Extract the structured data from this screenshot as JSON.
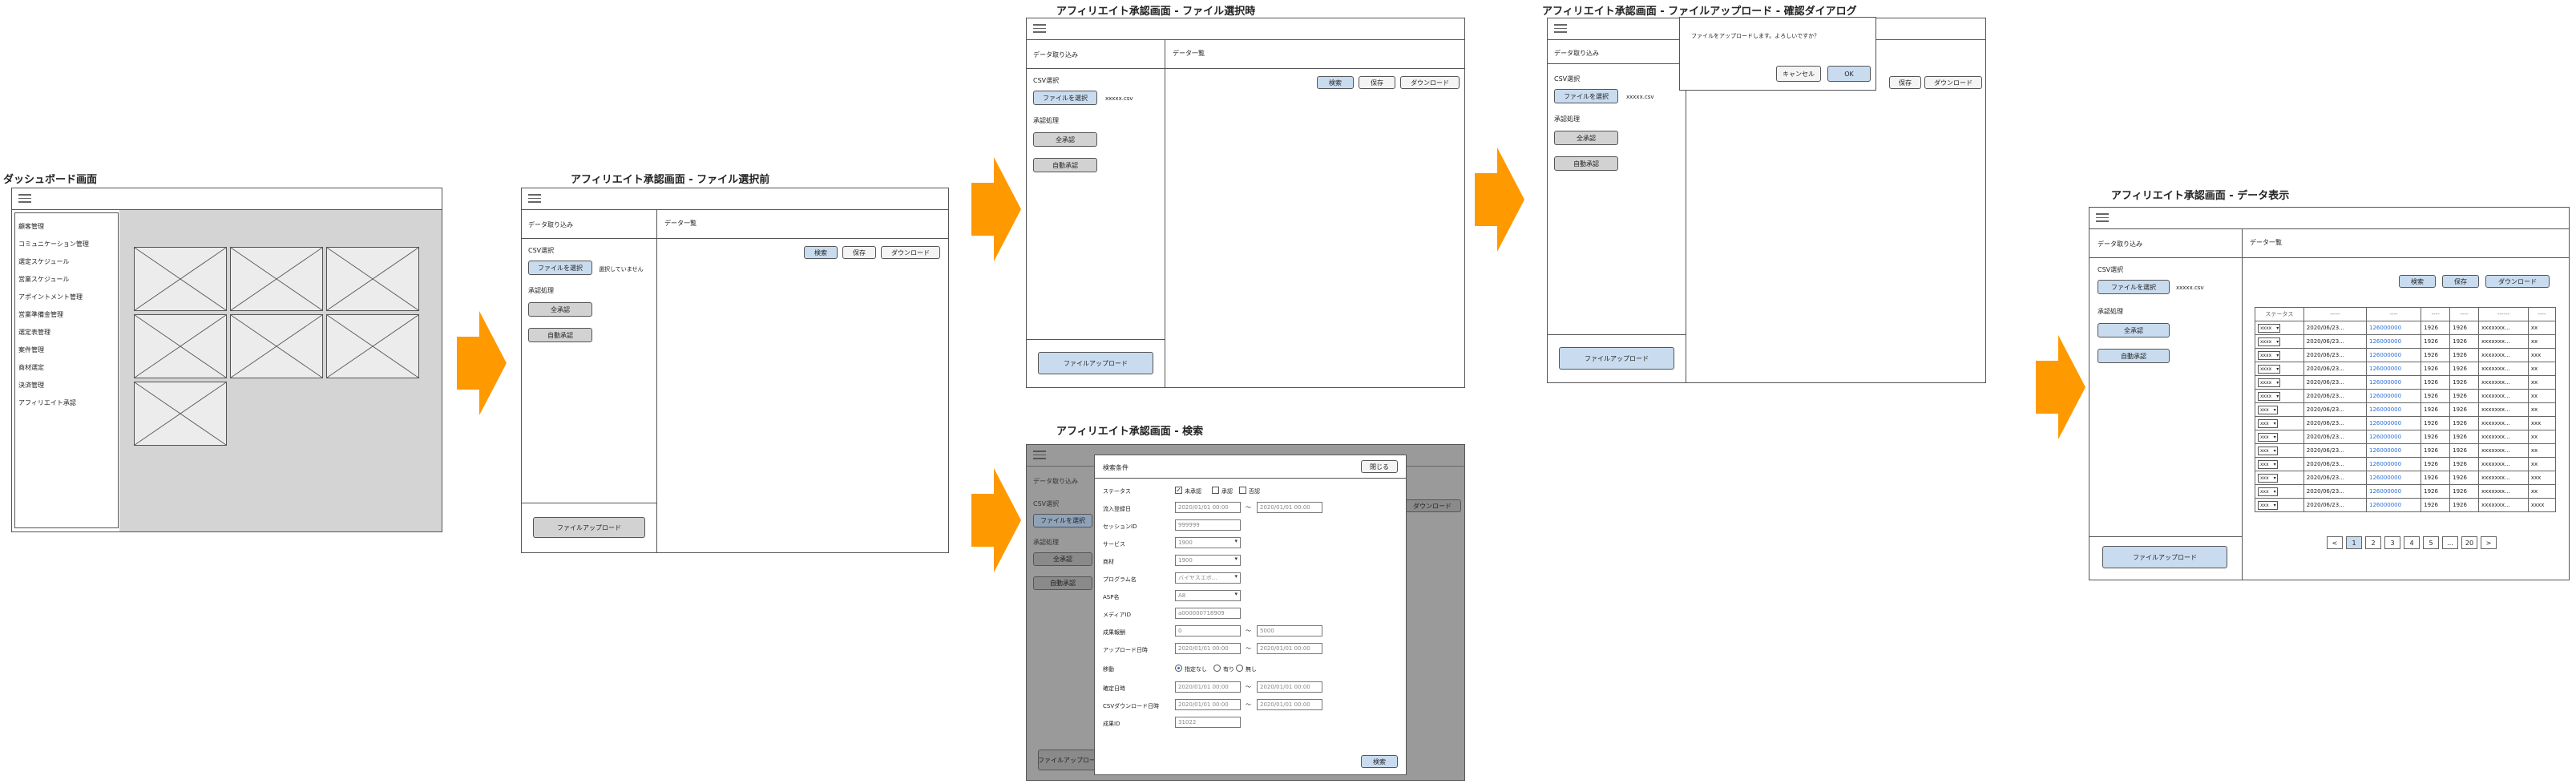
{
  "titles": {
    "dashboard": "ダッシュボード画面",
    "before": "アフィリエイト承認画面 - ファイル選択前",
    "selected": "アフィリエイト承認画面 - ファイル選択時",
    "confirm": "アフィリエイト承認画面 - ファイルアップロード - 確認ダイアログ",
    "search": "アフィリエイト承認画面 - 検索",
    "data": "アフィリエイト承認画面 - データ表示"
  },
  "dashboard": {
    "menu": [
      "顧客管理",
      "コミュニケーション管理",
      "選定スケジュール",
      "営業スケジュール",
      "アポイントメント管理",
      "営業準備金管理",
      "選定表管理",
      "案件管理",
      "商材選定",
      "決済管理",
      "アフィリエイト承認"
    ]
  },
  "common": {
    "import_header": "データ取り込み",
    "list_header": "データ一覧",
    "csv_label": "CSV選択",
    "file_button": "ファイルを選択",
    "approval_label": "承認処理",
    "all_approve": "全承認",
    "auto_approve": "自動承認",
    "upload_button": "ファイルアップロード",
    "search_button": "検索",
    "save_button": "保存",
    "download_button": "ダウンロード",
    "no_file": "選択していません",
    "file_name": "xxxxx.csv"
  },
  "confirm_dialog": {
    "message": "ファイルをアップロードします。よろしいですか？",
    "cancel": "キャンセル",
    "ok": "OK"
  },
  "search_dialog": {
    "title": "検索条件",
    "close": "閉じる",
    "search": "検索",
    "rows": [
      {
        "label": "ステータス"
      },
      {
        "label": "流入登録日"
      },
      {
        "label": "セッションID"
      },
      {
        "label": "サービス"
      },
      {
        "label": "商材"
      },
      {
        "label": "プログラム名"
      },
      {
        "label": "ASP名"
      },
      {
        "label": "メディアID"
      },
      {
        "label": "成果報酬"
      },
      {
        "label": "アップロード日時"
      },
      {
        "label": "移動"
      },
      {
        "label": "確定日時"
      },
      {
        "label": "CSVダウンロード日時"
      },
      {
        "label": "成果ID"
      }
    ],
    "status_options": [
      "未承認",
      "承認",
      "否認"
    ],
    "move_options": [
      "指定なし",
      "有り",
      "無し"
    ],
    "date_value": "2020/01/01 00:00",
    "session_value": "999999",
    "service_value": "1900",
    "product_value": "1900",
    "program_value": "バイヤスエボ...",
    "asp_value": "A8",
    "media_value": "a000000718909",
    "reward_from": "0",
    "reward_to": "5000",
    "result_id": "31022",
    "tilde": "〜"
  },
  "table": {
    "headers": [
      "ステータス",
      "-----",
      "----",
      "----",
      "----",
      "------",
      "----"
    ],
    "rows": [
      [
        "xxxx",
        "2020/06/23...",
        "126000000",
        "1926",
        "1926",
        "xxxxxxx...",
        "xx"
      ],
      [
        "xxxx",
        "2020/06/23...",
        "126000000",
        "1926",
        "1926",
        "xxxxxxx...",
        "xx"
      ],
      [
        "xxxx",
        "2020/06/23...",
        "126000000",
        "1926",
        "1926",
        "xxxxxxx...",
        "xxx"
      ],
      [
        "xxxx",
        "2020/06/23...",
        "126000000",
        "1926",
        "1926",
        "xxxxxxx...",
        "xx"
      ],
      [
        "xxxx",
        "2020/06/23...",
        "126000000",
        "1926",
        "1926",
        "xxxxxxx...",
        "xx"
      ],
      [
        "xxxx",
        "2020/06/23...",
        "126000000",
        "1926",
        "1926",
        "xxxxxxx...",
        "xx"
      ],
      [
        "xxx",
        "2020/06/23...",
        "126000000",
        "1926",
        "1926",
        "xxxxxxx...",
        "xx"
      ],
      [
        "xxx",
        "2020/06/23...",
        "126000000",
        "1926",
        "1926",
        "xxxxxxx...",
        "xxx"
      ],
      [
        "xxx",
        "2020/06/23...",
        "126000000",
        "1926",
        "1926",
        "xxxxxxx...",
        "xx"
      ],
      [
        "xxx",
        "2020/06/23...",
        "126000000",
        "1926",
        "1926",
        "xxxxxxx...",
        "xx"
      ],
      [
        "xxx",
        "2020/06/23...",
        "126000000",
        "1926",
        "1926",
        "xxxxxxx...",
        "xx"
      ],
      [
        "xxx",
        "2020/06/23...",
        "126000000",
        "1926",
        "1926",
        "xxxxxxx...",
        "xxx"
      ],
      [
        "xxx",
        "2020/06/23...",
        "126000000",
        "1926",
        "1926",
        "xxxxxxx...",
        "xx"
      ],
      [
        "xxx",
        "2020/06/23...",
        "126000000",
        "1926",
        "1926",
        "xxxxxxx...",
        "xxxx"
      ]
    ]
  },
  "pagination": [
    "<",
    "1",
    "2",
    "3",
    "4",
    "5",
    "...",
    "20",
    ">"
  ],
  "colors": {
    "arrow": "#ff9900",
    "blue_button": "#c9dcef",
    "link": "#2a6fd6"
  }
}
